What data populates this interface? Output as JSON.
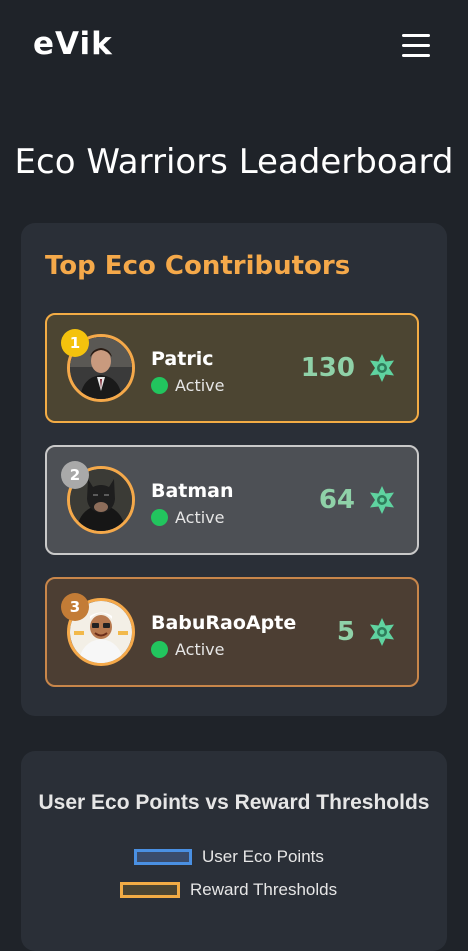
{
  "app": {
    "brand": "eVik"
  },
  "page": {
    "title": "Eco Warriors Leaderboard"
  },
  "leaderboard": {
    "title": "Top Eco Contributors",
    "entries": [
      {
        "rank": "1",
        "name": "Patric",
        "status": "Active",
        "points": "130"
      },
      {
        "rank": "2",
        "name": "Batman",
        "status": "Active",
        "points": "64"
      },
      {
        "rank": "3",
        "name": "BabuRaoApte",
        "status": "Active",
        "points": "5"
      }
    ]
  },
  "chart": {
    "title": "User Eco Points vs Reward Thresholds",
    "legend": [
      "User Eco Points",
      "Reward Thresholds"
    ]
  },
  "colors": {
    "accent": "#f5a94a",
    "points": "#8fd1a8",
    "active": "#22c55e",
    "rank1": "#f4c20d",
    "rank2": "#a9a9a9",
    "rank3": "#c37c36",
    "series1": "#4a90e2",
    "series2": "#f3ac45"
  },
  "icons": {
    "menu": "hamburger-menu-icon",
    "points": "eco-leaf-star-icon",
    "status": "status-dot-icon"
  }
}
